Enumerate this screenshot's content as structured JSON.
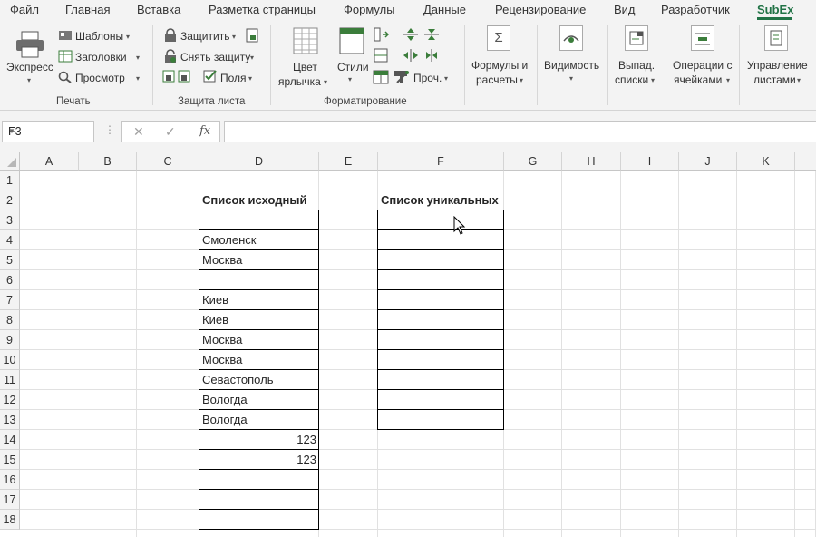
{
  "menu": {
    "tabs": [
      "Файл",
      "Главная",
      "Вставка",
      "Разметка страницы",
      "Формулы",
      "Данные",
      "Рецензирование",
      "Вид",
      "Разработчик",
      "SubEx"
    ],
    "active": "SubEx"
  },
  "ribbon": {
    "print_group": {
      "label": "Печать",
      "express": "Экспресс",
      "templates": "Шаблоны",
      "headers": "Заголовки",
      "preview": "Просмотр"
    },
    "protect_group": {
      "label": "Защита листа",
      "protect": "Защитить",
      "unprotect": "Снять защиту",
      "fields": "Поля"
    },
    "format_group": {
      "label": "Форматирование",
      "tab_color_1": "Цвет",
      "tab_color_2": "ярлычка",
      "styles": "Стили",
      "other": "Проч."
    },
    "formulas": {
      "line1": "Формулы и",
      "line2": "расчеты"
    },
    "visibility": {
      "line1": "Видимость"
    },
    "dropdowns": {
      "line1": "Выпад.",
      "line2": "списки"
    },
    "cell_ops": {
      "line1": "Операции с",
      "line2": "ячейками"
    },
    "sheets": {
      "line1": "Управление",
      "line2": "листами"
    }
  },
  "formula_bar": {
    "name_box": "F3",
    "cancel": "✕",
    "enter": "✓",
    "fx": "fx",
    "formula": ""
  },
  "sheet": {
    "columns": [
      "A",
      "B",
      "C",
      "D",
      "E",
      "F",
      "G",
      "H",
      "I",
      "J",
      "K"
    ],
    "rows": [
      "1",
      "2",
      "3",
      "4",
      "5",
      "6",
      "7",
      "8",
      "9",
      "10",
      "11",
      "12",
      "13",
      "14",
      "15",
      "16",
      "17",
      "18"
    ],
    "source_header": "Список исходный",
    "unique_header": "Список уникальных",
    "source_values": [
      "",
      "Смоленск",
      "Москва",
      "",
      "Киев",
      "Киев",
      "Москва",
      "Москва",
      "Севастополь",
      "Вологда",
      "Вологда",
      "123",
      "123",
      "",
      "",
      ""
    ],
    "unique_values": [
      "",
      "",
      "",
      "",
      "",
      "",
      "",
      "",
      "",
      "",
      ""
    ]
  },
  "colors": {
    "accent": "#217346",
    "ribbon_bg": "#f3f3f3",
    "grid_line": "#e1e1e1"
  }
}
